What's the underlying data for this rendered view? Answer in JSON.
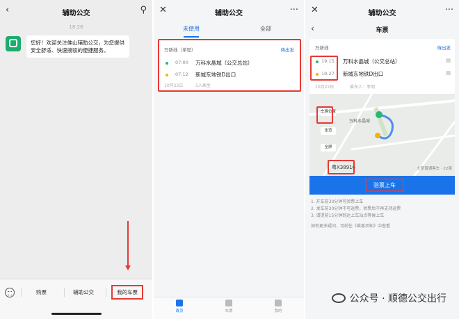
{
  "panel1": {
    "title": "辅助公交",
    "back_icon": "chevron-left-icon",
    "user_icon": "user-icon",
    "timestamp": "18:26",
    "message": "您好！欢迎关注佛山辅助公交，为您提供安全舒适、快速接驳的便捷服务。",
    "menu": [
      "购票",
      "辅助公交",
      "我的车票"
    ]
  },
  "panel2": {
    "title": "辅助公交",
    "close_icon": "close-icon",
    "more_icon": "more-icon",
    "tabs": [
      "未使用",
      "全部"
    ],
    "ticket": {
      "route": "万新线（单程）",
      "status": "待出发",
      "stops": [
        {
          "time": "07:00",
          "name": "万科水晶城（公交总站）"
        },
        {
          "time": "07:12",
          "name": "新城东地铁D出口"
        }
      ],
      "date": "10月22日",
      "passengers": "1人乘坐"
    },
    "tabbar": [
      "首页",
      "车票",
      "我的"
    ]
  },
  "panel3": {
    "title": "辅助公交",
    "subtitle": "车票",
    "route": "万新线",
    "status": "待出发",
    "stops": [
      {
        "time": "19:15",
        "name": "万科水晶城（公交总站）"
      },
      {
        "time": "19:27",
        "name": "新城东地铁D出口"
      }
    ],
    "date": "10月22日",
    "rider": "乘车人：李明",
    "map_label": "万科水晶城",
    "controls": [
      "车辆位置",
      "全览",
      "全屏"
    ],
    "plate": "粤X38916",
    "vehicle": "大型普通客车 · 22座",
    "verify_button": "验票上车",
    "notes": [
      "1. 开车前30分钟可验票上车",
      "2. 发车前30分钟不可退票，验票后不再支持退票",
      "3. 请提前15分钟到达上车站点等候上车"
    ],
    "faq": "如有更多疑问，可前往《乘客须知》中查看"
  },
  "watermark": "公众号 · 顺德公交出行"
}
